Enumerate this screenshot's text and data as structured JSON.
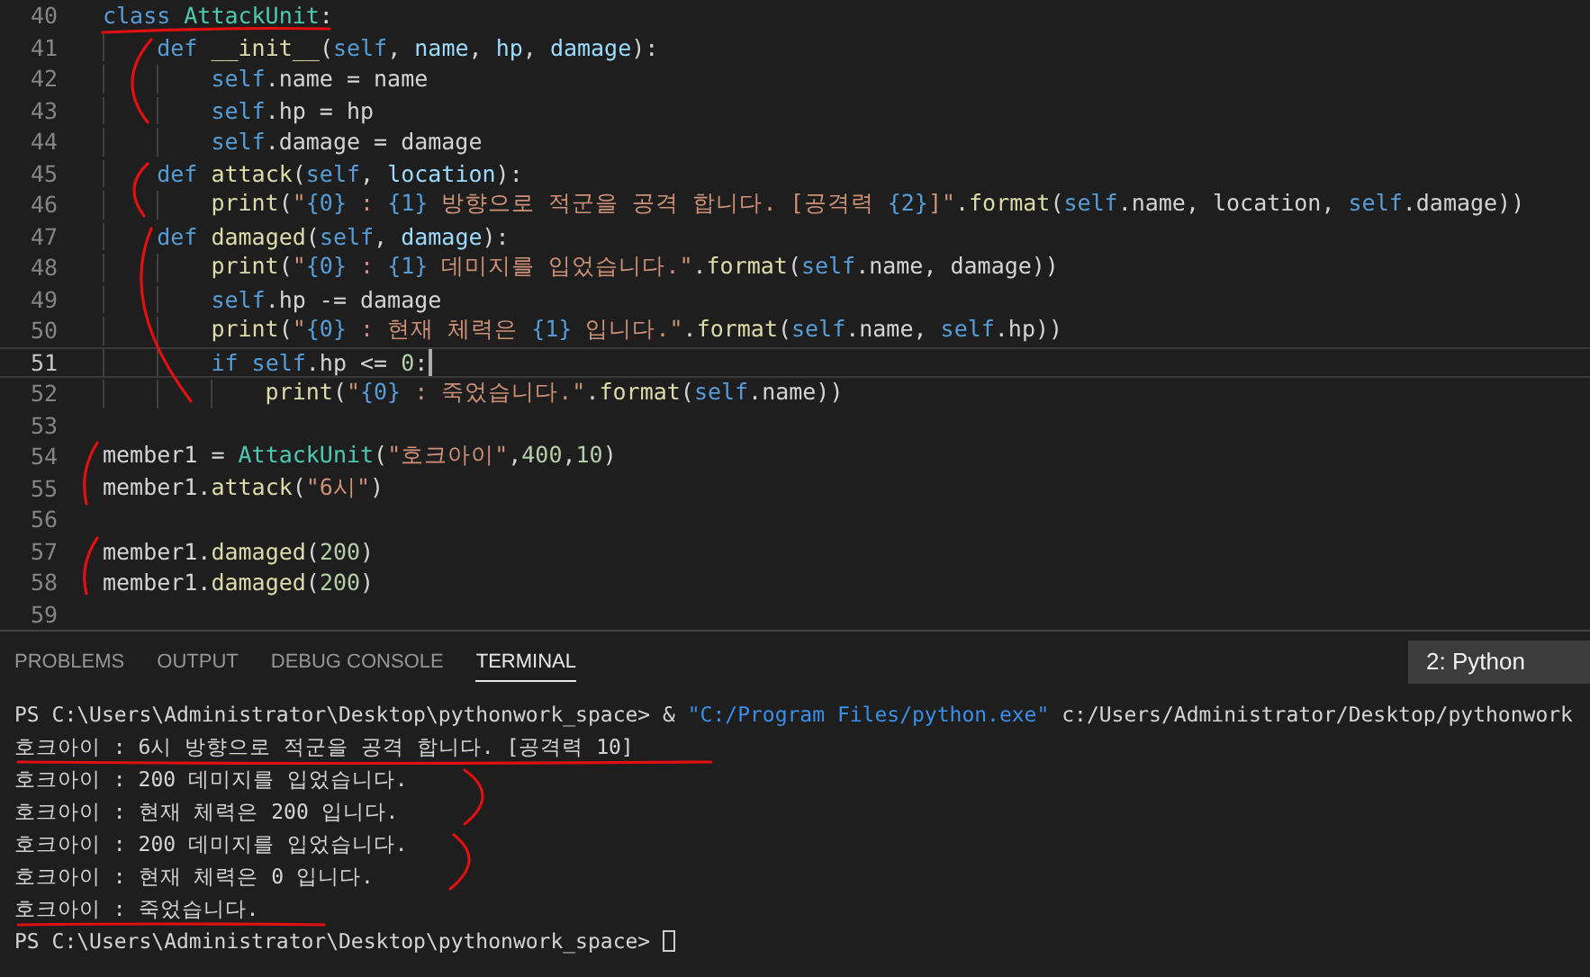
{
  "editor": {
    "lines": [
      {
        "number": "40",
        "current": false,
        "tokens": [
          {
            "kind": "kw",
            "text": "class "
          },
          {
            "kind": "cls",
            "text": "AttackUnit"
          },
          {
            "kind": "text",
            "text": ":"
          }
        ]
      },
      {
        "number": "41",
        "current": false,
        "tokens": [
          {
            "kind": "kw",
            "text": "    def "
          },
          {
            "kind": "fn",
            "text": "__init__"
          },
          {
            "kind": "text",
            "text": "("
          },
          {
            "kind": "self",
            "text": "self"
          },
          {
            "kind": "text",
            "text": ", "
          },
          {
            "kind": "param",
            "text": "name"
          },
          {
            "kind": "text",
            "text": ", "
          },
          {
            "kind": "param",
            "text": "hp"
          },
          {
            "kind": "text",
            "text": ", "
          },
          {
            "kind": "param",
            "text": "damage"
          },
          {
            "kind": "text",
            "text": "):"
          }
        ]
      },
      {
        "number": "42",
        "current": false,
        "tokens": [
          {
            "kind": "self",
            "text": "        self"
          },
          {
            "kind": "text",
            "text": ".name = name"
          }
        ]
      },
      {
        "number": "43",
        "current": false,
        "tokens": [
          {
            "kind": "self",
            "text": "        self"
          },
          {
            "kind": "text",
            "text": ".hp = hp"
          }
        ]
      },
      {
        "number": "44",
        "current": false,
        "tokens": [
          {
            "kind": "self",
            "text": "        self"
          },
          {
            "kind": "text",
            "text": ".damage = damage"
          }
        ]
      },
      {
        "number": "45",
        "current": false,
        "tokens": [
          {
            "kind": "kw",
            "text": "    def "
          },
          {
            "kind": "fn",
            "text": "attack"
          },
          {
            "kind": "text",
            "text": "("
          },
          {
            "kind": "self",
            "text": "self"
          },
          {
            "kind": "text",
            "text": ", "
          },
          {
            "kind": "param",
            "text": "location"
          },
          {
            "kind": "text",
            "text": "):"
          }
        ]
      },
      {
        "number": "46",
        "current": false,
        "tokens": [
          {
            "kind": "fn",
            "text": "        print"
          },
          {
            "kind": "text",
            "text": "("
          },
          {
            "kind": "str",
            "text": "\""
          },
          {
            "kind": "fmt",
            "text": "{0}"
          },
          {
            "kind": "str",
            "text": " : "
          },
          {
            "kind": "fmt",
            "text": "{1}"
          },
          {
            "kind": "str",
            "text": " 방향으로 적군을 공격 합니다. [공격력 "
          },
          {
            "kind": "fmt",
            "text": "{2}"
          },
          {
            "kind": "str",
            "text": "]\""
          },
          {
            "kind": "text",
            "text": "."
          },
          {
            "kind": "fn",
            "text": "format"
          },
          {
            "kind": "text",
            "text": "("
          },
          {
            "kind": "self",
            "text": "self"
          },
          {
            "kind": "text",
            "text": ".name, location, "
          },
          {
            "kind": "self",
            "text": "self"
          },
          {
            "kind": "text",
            "text": ".damage))"
          }
        ]
      },
      {
        "number": "47",
        "current": false,
        "tokens": [
          {
            "kind": "kw",
            "text": "    def "
          },
          {
            "kind": "fn",
            "text": "damaged"
          },
          {
            "kind": "text",
            "text": "("
          },
          {
            "kind": "self",
            "text": "self"
          },
          {
            "kind": "text",
            "text": ", "
          },
          {
            "kind": "param",
            "text": "damage"
          },
          {
            "kind": "text",
            "text": "):"
          }
        ]
      },
      {
        "number": "48",
        "current": false,
        "tokens": [
          {
            "kind": "fn",
            "text": "        print"
          },
          {
            "kind": "text",
            "text": "("
          },
          {
            "kind": "str",
            "text": "\""
          },
          {
            "kind": "fmt",
            "text": "{0}"
          },
          {
            "kind": "str",
            "text": " : "
          },
          {
            "kind": "fmt",
            "text": "{1}"
          },
          {
            "kind": "str",
            "text": " 데미지를 입었습니다.\""
          },
          {
            "kind": "text",
            "text": "."
          },
          {
            "kind": "fn",
            "text": "format"
          },
          {
            "kind": "text",
            "text": "("
          },
          {
            "kind": "self",
            "text": "self"
          },
          {
            "kind": "text",
            "text": ".name, damage))"
          }
        ]
      },
      {
        "number": "49",
        "current": false,
        "tokens": [
          {
            "kind": "self",
            "text": "        self"
          },
          {
            "kind": "text",
            "text": ".hp -= damage"
          }
        ]
      },
      {
        "number": "50",
        "current": false,
        "tokens": [
          {
            "kind": "fn",
            "text": "        print"
          },
          {
            "kind": "text",
            "text": "("
          },
          {
            "kind": "str",
            "text": "\""
          },
          {
            "kind": "fmt",
            "text": "{0}"
          },
          {
            "kind": "str",
            "text": " : 현재 체력은 "
          },
          {
            "kind": "fmt",
            "text": "{1}"
          },
          {
            "kind": "str",
            "text": " 입니다.\""
          },
          {
            "kind": "text",
            "text": "."
          },
          {
            "kind": "fn",
            "text": "format"
          },
          {
            "kind": "text",
            "text": "("
          },
          {
            "kind": "self",
            "text": "self"
          },
          {
            "kind": "text",
            "text": ".name, "
          },
          {
            "kind": "self",
            "text": "self"
          },
          {
            "kind": "text",
            "text": ".hp))"
          }
        ]
      },
      {
        "number": "51",
        "current": true,
        "tokens": [
          {
            "kind": "kw",
            "text": "        if "
          },
          {
            "kind": "self",
            "text": "self"
          },
          {
            "kind": "text",
            "text": ".hp <= "
          },
          {
            "kind": "num",
            "text": "0"
          },
          {
            "kind": "text",
            "text": ":"
          }
        ]
      },
      {
        "number": "52",
        "current": false,
        "tokens": [
          {
            "kind": "fn",
            "text": "            print"
          },
          {
            "kind": "text",
            "text": "("
          },
          {
            "kind": "str",
            "text": "\""
          },
          {
            "kind": "fmt",
            "text": "{0}"
          },
          {
            "kind": "str",
            "text": " : 죽었습니다.\""
          },
          {
            "kind": "text",
            "text": "."
          },
          {
            "kind": "fn",
            "text": "format"
          },
          {
            "kind": "text",
            "text": "("
          },
          {
            "kind": "self",
            "text": "self"
          },
          {
            "kind": "text",
            "text": ".name))"
          }
        ]
      },
      {
        "number": "53",
        "current": false
      },
      {
        "number": "54",
        "current": false,
        "tokens": [
          {
            "kind": "text",
            "text": "member1 = "
          },
          {
            "kind": "cls",
            "text": "AttackUnit"
          },
          {
            "kind": "text",
            "text": "("
          },
          {
            "kind": "str",
            "text": "\"호크아이\""
          },
          {
            "kind": "text",
            "text": ","
          },
          {
            "kind": "num",
            "text": "400"
          },
          {
            "kind": "text",
            "text": ","
          },
          {
            "kind": "num",
            "text": "10"
          },
          {
            "kind": "text",
            "text": ")"
          }
        ]
      },
      {
        "number": "55",
        "current": false,
        "tokens": [
          {
            "kind": "text",
            "text": "member1."
          },
          {
            "kind": "fn",
            "text": "attack"
          },
          {
            "kind": "text",
            "text": "("
          },
          {
            "kind": "str",
            "text": "\"6시\""
          },
          {
            "kind": "text",
            "text": ")"
          }
        ]
      },
      {
        "number": "56",
        "current": false
      },
      {
        "number": "57",
        "current": false,
        "tokens": [
          {
            "kind": "text",
            "text": "member1."
          },
          {
            "kind": "fn",
            "text": "damaged"
          },
          {
            "kind": "text",
            "text": "("
          },
          {
            "kind": "num",
            "text": "200"
          },
          {
            "kind": "text",
            "text": ")"
          }
        ]
      },
      {
        "number": "58",
        "current": false,
        "tokens": [
          {
            "kind": "text",
            "text": "member1."
          },
          {
            "kind": "fn",
            "text": "damaged"
          },
          {
            "kind": "text",
            "text": "("
          },
          {
            "kind": "num",
            "text": "200"
          },
          {
            "kind": "text",
            "text": ")"
          }
        ]
      },
      {
        "number": "59",
        "current": false
      }
    ]
  },
  "panel": {
    "tabs": [
      {
        "label": "PROBLEMS",
        "selected": false
      },
      {
        "label": "OUTPUT",
        "selected": false
      },
      {
        "label": "DEBUG CONSOLE",
        "selected": false
      },
      {
        "label": "TERMINAL",
        "selected": true
      }
    ],
    "terminal_select": "2: Python",
    "terminal": [
      {
        "cursor": false,
        "tokens": [
          {
            "kind": "text",
            "text": "PS C:\\Users\\Administrator\\Desktop\\pythonwork_space> & "
          },
          {
            "kind": "path",
            "text": "\"C:/Program Files/python.exe\""
          },
          {
            "kind": "text",
            "text": " c:/Users/Administrator/Desktop/pythonwork"
          }
        ]
      },
      {
        "cursor": false,
        "tokens": [
          {
            "kind": "text",
            "text": "호크아이 : 6시 방향으로 적군을 공격 합니다. [공격력 10]"
          }
        ]
      },
      {
        "cursor": false,
        "tokens": [
          {
            "kind": "text",
            "text": "호크아이 : 200 데미지를 입었습니다."
          }
        ]
      },
      {
        "cursor": false,
        "tokens": [
          {
            "kind": "text",
            "text": "호크아이 : 현재 체력은 200 입니다."
          }
        ]
      },
      {
        "cursor": false,
        "tokens": [
          {
            "kind": "text",
            "text": "호크아이 : 200 데미지를 입었습니다."
          }
        ]
      },
      {
        "cursor": false,
        "tokens": [
          {
            "kind": "text",
            "text": "호크아이 : 현재 체력은 0 입니다."
          }
        ]
      },
      {
        "cursor": false,
        "tokens": [
          {
            "kind": "text",
            "text": "호크아이 : 죽었습니다."
          }
        ]
      },
      {
        "cursor": true,
        "tokens": [
          {
            "kind": "text",
            "text": "PS C:\\Users\\Administrator\\Desktop\\pythonwork_space> "
          }
        ]
      }
    ]
  }
}
